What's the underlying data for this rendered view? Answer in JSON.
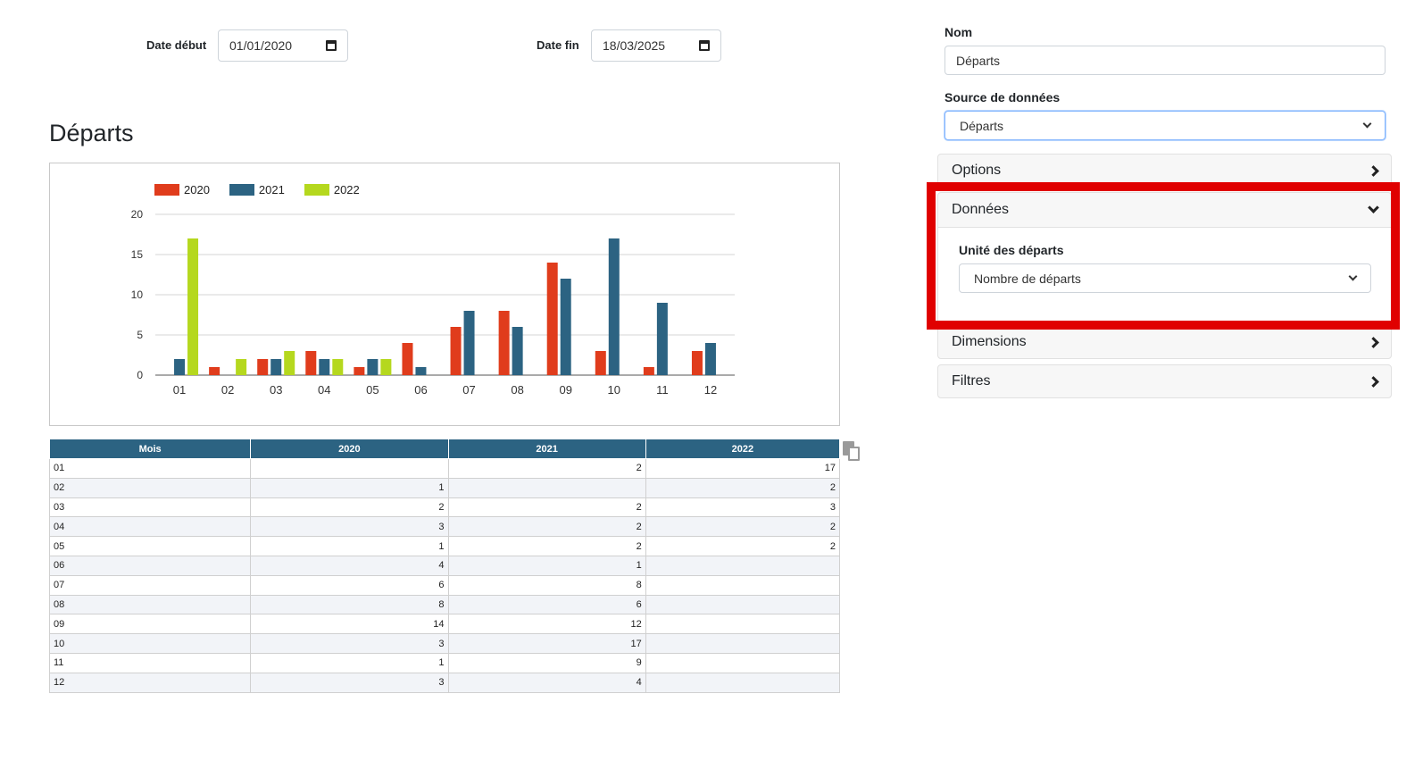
{
  "filters": {
    "date_debut_label": "Date début",
    "date_debut_value": "01/01/2020",
    "date_fin_label": "Date fin",
    "date_fin_value": "18/03/2025"
  },
  "page_title": "Départs",
  "chart_data": {
    "type": "bar",
    "title": "",
    "xlabel": "",
    "ylabel": "",
    "categories": [
      "01",
      "02",
      "03",
      "04",
      "05",
      "06",
      "07",
      "08",
      "09",
      "10",
      "11",
      "12"
    ],
    "series": [
      {
        "name": "2020",
        "color": "#e03c1c",
        "values": [
          0,
          1,
          2,
          3,
          1,
          4,
          6,
          8,
          14,
          3,
          1,
          3
        ]
      },
      {
        "name": "2021",
        "color": "#2c6382",
        "values": [
          2,
          0,
          2,
          2,
          2,
          1,
          8,
          6,
          12,
          17,
          9,
          4
        ]
      },
      {
        "name": "2022",
        "color": "#b5d81e",
        "values": [
          17,
          2,
          3,
          2,
          2,
          0,
          0,
          0,
          0,
          0,
          0,
          0
        ]
      }
    ],
    "ylim": [
      0,
      20
    ],
    "yticks": [
      0,
      5,
      10,
      15,
      20
    ],
    "grid": true,
    "legend": "top-left"
  },
  "table": {
    "headers": [
      "Mois",
      "2020",
      "2021",
      "2022"
    ],
    "rows": [
      [
        "01",
        "",
        "2",
        "17"
      ],
      [
        "02",
        "1",
        "",
        "2"
      ],
      [
        "03",
        "2",
        "2",
        "3"
      ],
      [
        "04",
        "3",
        "2",
        "2"
      ],
      [
        "05",
        "1",
        "2",
        "2"
      ],
      [
        "06",
        "4",
        "1",
        ""
      ],
      [
        "07",
        "6",
        "8",
        ""
      ],
      [
        "08",
        "8",
        "6",
        ""
      ],
      [
        "09",
        "14",
        "12",
        ""
      ],
      [
        "10",
        "3",
        "17",
        ""
      ],
      [
        "11",
        "1",
        "9",
        ""
      ],
      [
        "12",
        "3",
        "4",
        ""
      ]
    ]
  },
  "side_panel": {
    "nom_label": "Nom",
    "nom_value": "Départs",
    "source_label": "Source de données",
    "source_value": "Départs",
    "sections": {
      "options": "Options",
      "donnees": "Données",
      "dimensions": "Dimensions",
      "filtres": "Filtres"
    },
    "unite_label": "Unité des départs",
    "unite_value": "Nombre de départs"
  },
  "colors": {
    "highlight": "#e00000",
    "table_header": "#2c6382"
  }
}
